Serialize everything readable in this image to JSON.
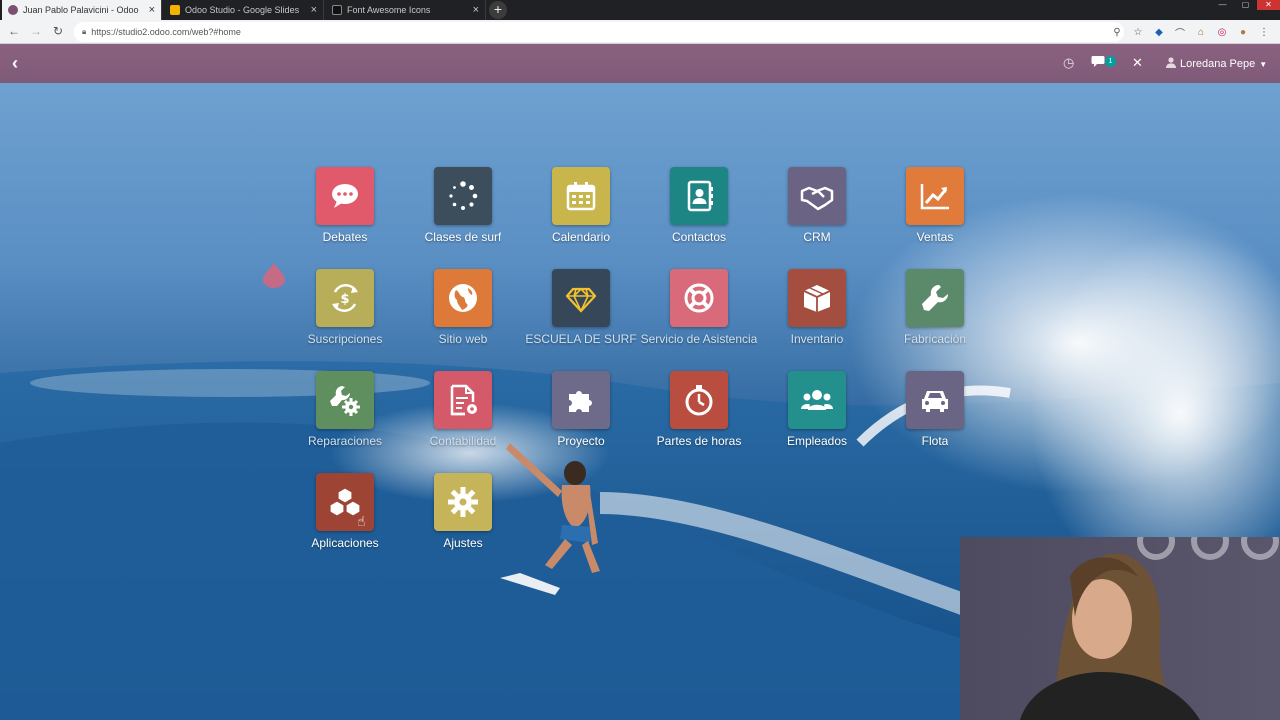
{
  "browser": {
    "tabs": [
      {
        "title": "Juan Pablo Palavicini - Odoo",
        "favicon_color": "#7c4f73",
        "active": true
      },
      {
        "title": "Odoo Studio - Google Slides",
        "favicon_color": "#f4b400",
        "active": false
      },
      {
        "title": "Font Awesome Icons",
        "favicon_color": "#222222",
        "active": false
      }
    ],
    "new_tab_symbol": "+",
    "url": "https://studio2.odoo.com/web?#home"
  },
  "odoo_bar": {
    "color": "#875a7b",
    "message_count": "1",
    "user_name": "Loredana Pepe"
  },
  "apps": [
    {
      "label": "Debates",
      "color": "#e05a6b",
      "icon": "chat-bubble-icon"
    },
    {
      "label": "Clases de surf",
      "color": "#3c4d5c",
      "icon": "spinner-icon"
    },
    {
      "label": "Calendario",
      "color": "#c8b64d",
      "icon": "calendar-icon"
    },
    {
      "label": "Contactos",
      "color": "#1e8585",
      "icon": "address-book-icon"
    },
    {
      "label": "CRM",
      "color": "#6a6383",
      "icon": "handshake-icon"
    },
    {
      "label": "Ventas",
      "color": "#e07b3c",
      "icon": "line-chart-icon"
    },
    {
      "label": "Suscripciones",
      "color": "#b8ae5a",
      "icon": "recurring-dollar-icon"
    },
    {
      "label": "Sitio web",
      "color": "#dd7a3a",
      "icon": "globe-icon"
    },
    {
      "label": "ESCUELA DE SURF",
      "color": "#37475a",
      "icon": "diamond-icon"
    },
    {
      "label": "Servicio de Asistencia",
      "color": "#d96a7a",
      "icon": "life-ring-icon"
    },
    {
      "label": "Inventario",
      "color": "#a34e3e",
      "icon": "box-icon"
    },
    {
      "label": "Fabricación",
      "color": "#5a8a6a",
      "icon": "wrench-icon"
    },
    {
      "label": "Reparaciones",
      "color": "#5f8e5f",
      "icon": "wrench-gear-icon"
    },
    {
      "label": "Contabilidad",
      "color": "#d45a6a",
      "icon": "document-gear-icon"
    },
    {
      "label": "Proyecto",
      "color": "#6e6a8a",
      "icon": "puzzle-icon"
    },
    {
      "label": "Partes de horas",
      "color": "#b94e40",
      "icon": "stopwatch-icon"
    },
    {
      "label": "Empleados",
      "color": "#24908d",
      "icon": "users-icon"
    },
    {
      "label": "Flota",
      "color": "#6b6585",
      "icon": "car-icon"
    },
    {
      "label": "Aplicaciones",
      "color": "#9e4434",
      "icon": "cubes-icon"
    },
    {
      "label": "Ajustes",
      "color": "#c6b45a",
      "icon": "gear-icon"
    }
  ]
}
